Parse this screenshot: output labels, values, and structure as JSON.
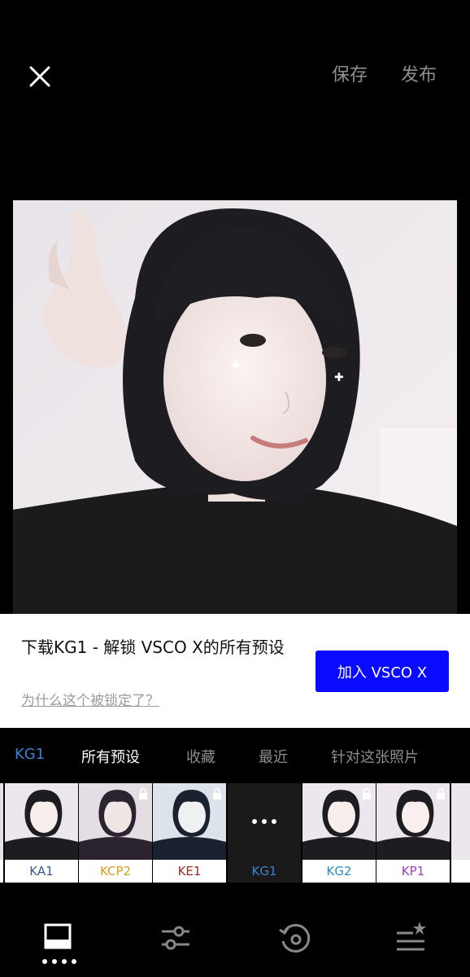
{
  "header": {
    "save_label": "保存",
    "publish_label": "发布"
  },
  "banner": {
    "message": "下载KG1 - 解锁 VSCO X的所有预设",
    "link": "为什么这个被锁定了？",
    "button_label": "加入 VSCO X",
    "button_color": "#0a0aff"
  },
  "tabs": [
    {
      "label": "KG1",
      "color": "#3b82d6"
    },
    {
      "label": "所有预设",
      "color": "#ffffff"
    },
    {
      "label": "收藏",
      "color": "#8e8e8e"
    },
    {
      "label": "最近",
      "color": "#8e8e8e"
    },
    {
      "label": "针对这张照片",
      "color": "#8e8e8e"
    }
  ],
  "presets": [
    {
      "label": "KA1",
      "color": "#3a5a8c",
      "locked": false
    },
    {
      "label": "KCP2",
      "color": "#d4a017",
      "locked": true
    },
    {
      "label": "KE1",
      "color": "#9c2a2a",
      "locked": true
    },
    {
      "label": "KG1",
      "color": "#3b82d6",
      "selected": true
    },
    {
      "label": "KG2",
      "color": "#2a8fbf",
      "locked": true
    },
    {
      "label": "KP1",
      "color": "#9b3fbf",
      "locked": true
    }
  ],
  "toolbar": {
    "items": [
      "presets-icon",
      "adjust-sliders-icon",
      "history-icon",
      "recipes-icon"
    ],
    "active_dots": 4
  }
}
